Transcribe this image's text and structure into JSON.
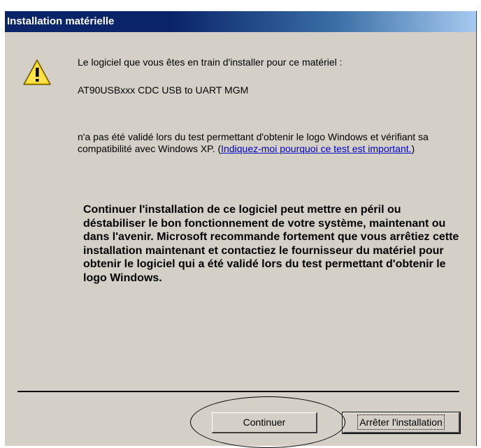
{
  "dialog": {
    "title": "Installation matérielle",
    "message_intro": "Le logiciel que vous êtes en train d'installer pour ce matériel :",
    "device_name": "AT90USBxxx CDC USB to UART MGM",
    "message_not_validated": "n'a pas été validé lors du test permettant d'obtenir le logo Windows et vérifiant sa compatibilité avec Windows XP. (",
    "link_text": "Indiquez-moi pourquoi ce test est important.",
    "message_close_paren": ")",
    "warning_text": "Continuer l'installation de ce logiciel peut mettre en péril ou déstabiliser le bon fonctionnement de votre système, maintenant ou dans l'avenir. Microsoft recommande fortement que vous arrêtiez cette installation maintenant et contactiez le fournisseur du matériel pour obtenir le logiciel qui a été validé lors du test permettant d'obtenir le logo Windows.",
    "icon": "warning-icon"
  },
  "buttons": {
    "continue_label": "Continuer",
    "stop_label": "Arrêter l'installation"
  },
  "colors": {
    "titlebar": "#0a246a",
    "face": "#d4d0c8",
    "link": "#0000cc"
  }
}
